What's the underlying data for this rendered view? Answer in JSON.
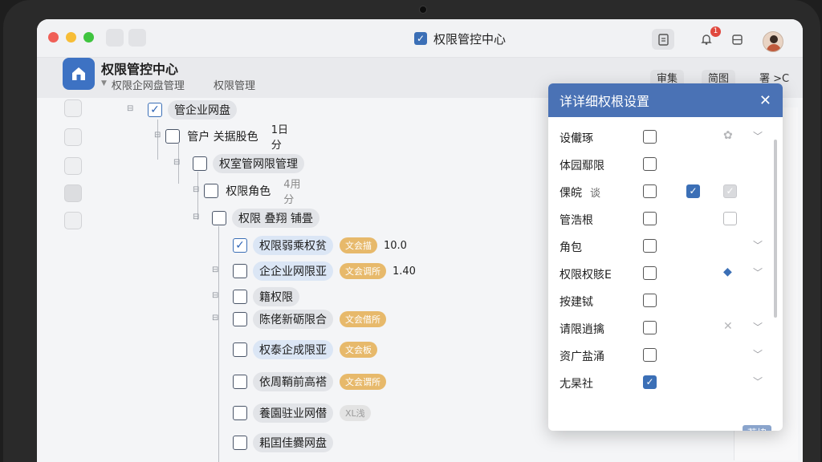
{
  "window": {
    "title": "权限管控中心"
  },
  "header": {
    "app_title": "权限管控中心",
    "breadcrumb": [
      "权限企网盘管理",
      "权限管理"
    ],
    "buttons": [
      "审集",
      "简图",
      "署 >C"
    ]
  },
  "tree": [
    {
      "label": "管企业网盘",
      "checked": true,
      "style": "grey"
    },
    {
      "label": "管户 关据股色",
      "value": "1日 分",
      "checked": false,
      "style": "plain"
    },
    {
      "label": "权室管网限管理",
      "checked": false,
      "style": "grey"
    },
    {
      "label": "权限角色",
      "value": "4用 分",
      "checked": false,
      "style": "plain"
    },
    {
      "label": "权限 叠翔 铺畳",
      "checked": false,
      "style": "grey"
    },
    {
      "label": "权限弱乘权贫",
      "tag": "文会描",
      "value": "10.0",
      "checked": true,
      "style": "blue"
    },
    {
      "label": "企企业网限亚",
      "tag": "文会调所",
      "value": "1.40",
      "checked": false,
      "style": "blue"
    },
    {
      "label": "籍权限",
      "checked": false,
      "style": "grey"
    },
    {
      "label": "陈佬新砺限合",
      "tag": "文会借所",
      "checked": false,
      "style": "grey"
    },
    {
      "label": "权泰企成限亚",
      "tag": "文会板",
      "checked": false,
      "style": "blue"
    },
    {
      "label": "依周鞘前高褡",
      "tag": "文会谓所",
      "checked": false,
      "style": "grey"
    },
    {
      "label": "養園驻业网僣",
      "tag": "XL浅",
      "tag_style": "grey",
      "checked": false,
      "style": "grey"
    },
    {
      "label": "耜囯佳爨网盘",
      "checked": false,
      "style": "grey"
    }
  ],
  "dialog": {
    "title": "详详细权根设置",
    "close": "✕",
    "rows": [
      {
        "label": "设儎琢",
        "chev": true
      },
      {
        "label": "体园鄢限"
      },
      {
        "label": "倮皖",
        "extra": "谈",
        "checked2": true,
        "checked3": true
      },
      {
        "label": "管浩根",
        "cb3": true
      },
      {
        "label": "角包",
        "chev": true
      },
      {
        "label": "权限权賅E",
        "icon": "◆",
        "chev": true
      },
      {
        "label": "按建铽"
      },
      {
        "label": "请限逍擒",
        "icon": "✕",
        "chev": true
      },
      {
        "label": "资广盐涌",
        "chev": true
      },
      {
        "label": "尢杲社",
        "checked1": true,
        "chev": true
      }
    ],
    "button": "荐協"
  },
  "colors": {
    "accent": "#3b6fb6",
    "dialog_header": "#4a72b5",
    "tag": "#e7b96b",
    "notification": "#e0483e"
  },
  "notification_count": "1"
}
